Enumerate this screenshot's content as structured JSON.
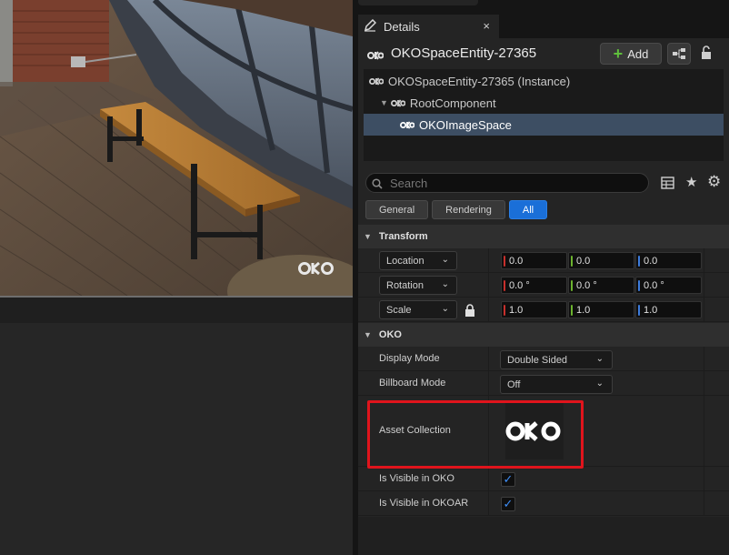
{
  "viewport": {
    "watermark": "OKO",
    "watermark_icon": "oko-logo-icon"
  },
  "details_tab": {
    "label": "Details",
    "icon": "pencil-icon",
    "close": "×"
  },
  "entity": {
    "name": "OKOSpaceEntity-27365",
    "add_label": "Add"
  },
  "tree": {
    "items": [
      {
        "label": "OKOSpaceEntity-27365 (Instance)",
        "selected": false
      },
      {
        "label": "RootComponent",
        "selected": false
      },
      {
        "label": "OKOImageSpace",
        "selected": true
      }
    ]
  },
  "search": {
    "placeholder": "Search"
  },
  "filters": [
    "General",
    "Rendering",
    "All"
  ],
  "active_filter": "All",
  "sections": {
    "transform": "Transform",
    "oko": "OKO"
  },
  "transform": {
    "location": {
      "label": "Location",
      "x": "0.0",
      "y": "0.0",
      "z": "0.0"
    },
    "rotation": {
      "label": "Rotation",
      "x": "0.0 °",
      "y": "0.0 °",
      "z": "0.0 °"
    },
    "scale": {
      "label": "Scale",
      "x": "1.0",
      "y": "1.0",
      "z": "1.0"
    }
  },
  "oko": {
    "display_mode": {
      "label": "Display Mode",
      "value": "Double Sided"
    },
    "billboard_mode": {
      "label": "Billboard Mode",
      "value": "Off"
    },
    "asset_collection": {
      "label": "Asset Collection",
      "thumbnail": "OKO"
    },
    "visible_oko": {
      "label": "Is Visible in OKO",
      "checked": true
    },
    "visible_okoar": {
      "label": "Is Visible in OKOAR",
      "checked": true
    }
  },
  "colors": {
    "accent": "#1a6fd8",
    "selection": "#3d4e63",
    "highlight": "#e0141c",
    "axis_x": "#c8302c",
    "axis_y": "#6cb32e",
    "axis_z": "#3c7bdc"
  }
}
